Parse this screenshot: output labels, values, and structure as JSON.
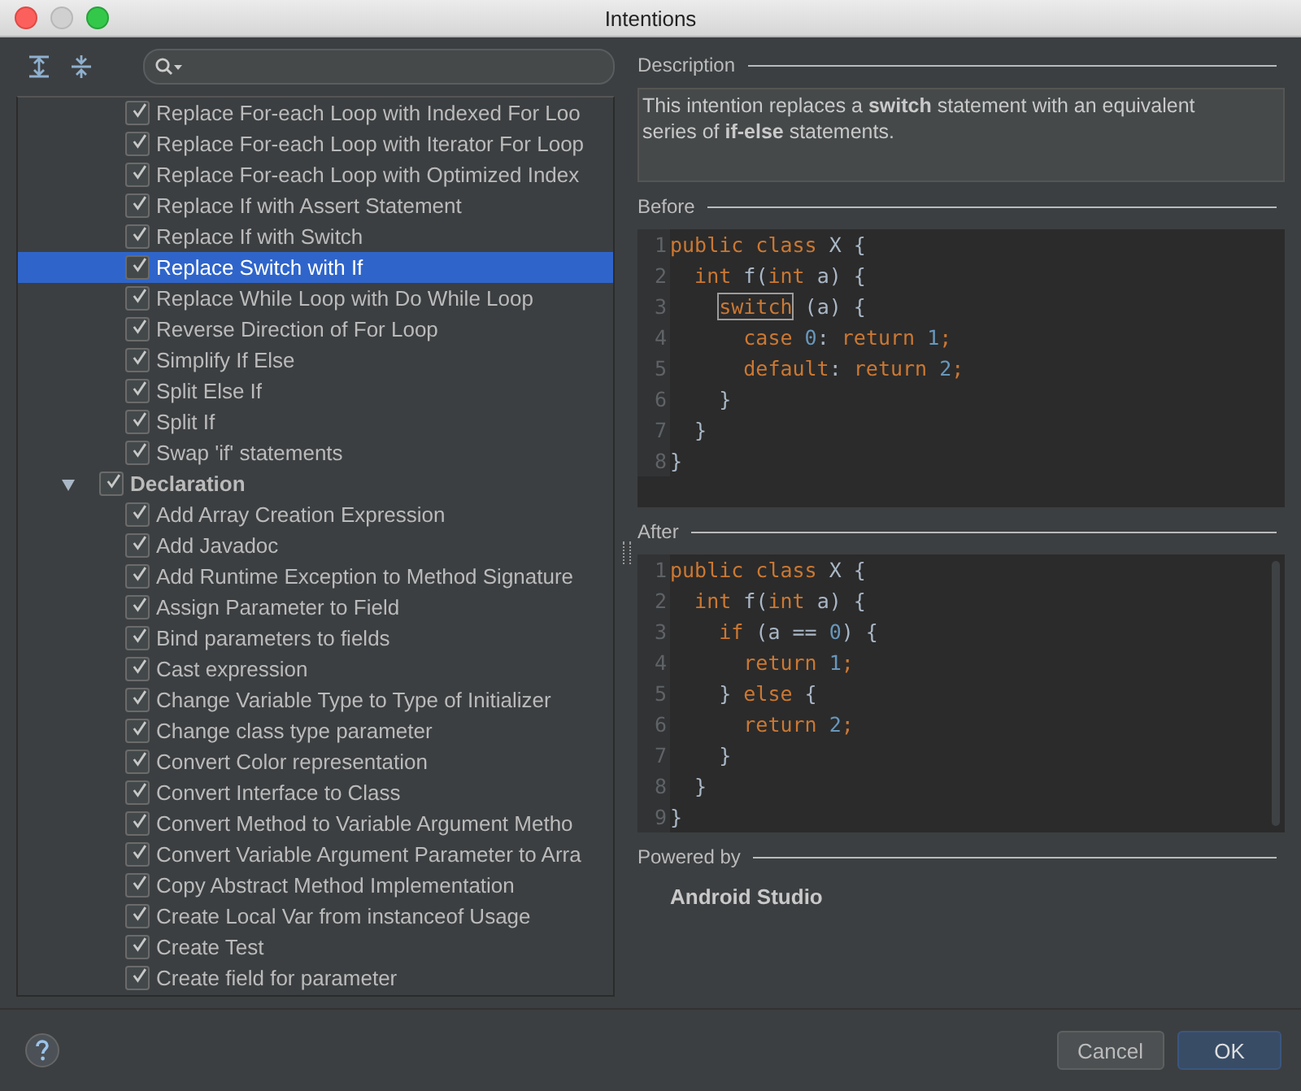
{
  "window": {
    "title": "Intentions"
  },
  "tree": [
    {
      "label": "Replace For-each Loop with Indexed For Loo",
      "checked": true,
      "selected": false
    },
    {
      "label": "Replace For-each Loop with Iterator For Loop",
      "checked": true,
      "selected": false
    },
    {
      "label": "Replace For-each Loop with Optimized Index",
      "checked": true,
      "selected": false
    },
    {
      "label": "Replace If with Assert Statement",
      "checked": true,
      "selected": false
    },
    {
      "label": "Replace If with Switch",
      "checked": true,
      "selected": false
    },
    {
      "label": "Replace Switch with If",
      "checked": true,
      "selected": true
    },
    {
      "label": "Replace While Loop with Do While Loop",
      "checked": true,
      "selected": false
    },
    {
      "label": "Reverse Direction of For Loop",
      "checked": true,
      "selected": false
    },
    {
      "label": "Simplify If Else",
      "checked": true,
      "selected": false
    },
    {
      "label": "Split Else If",
      "checked": true,
      "selected": false
    },
    {
      "label": "Split If",
      "checked": true,
      "selected": false
    },
    {
      "label": "Swap 'if' statements",
      "checked": true,
      "selected": false
    },
    {
      "label": "Declaration",
      "checked": true,
      "selected": false,
      "expanded": true,
      "children": [
        {
          "label": "Add Array Creation Expression",
          "checked": true,
          "selected": false
        },
        {
          "label": "Add Javadoc",
          "checked": true,
          "selected": false
        },
        {
          "label": "Add Runtime Exception to Method Signature",
          "checked": true,
          "selected": false
        },
        {
          "label": "Assign Parameter to Field",
          "checked": true,
          "selected": false
        },
        {
          "label": "Bind parameters to fields",
          "checked": true,
          "selected": false
        },
        {
          "label": "Cast expression",
          "checked": true,
          "selected": false
        },
        {
          "label": "Change Variable Type to Type of Initializer",
          "checked": true,
          "selected": false
        },
        {
          "label": "Change class type parameter",
          "checked": true,
          "selected": false
        },
        {
          "label": "Convert Color representation",
          "checked": true,
          "selected": false
        },
        {
          "label": "Convert Interface to Class",
          "checked": true,
          "selected": false
        },
        {
          "label": "Convert Method to Variable Argument Metho",
          "checked": true,
          "selected": false
        },
        {
          "label": "Convert Variable Argument Parameter to Arra",
          "checked": true,
          "selected": false
        },
        {
          "label": "Copy Abstract Method Implementation",
          "checked": true,
          "selected": false
        },
        {
          "label": "Create Local Var from instanceof Usage",
          "checked": true,
          "selected": false
        },
        {
          "label": "Create Test",
          "checked": true,
          "selected": false
        },
        {
          "label": "Create field for parameter",
          "checked": true,
          "selected": false
        }
      ]
    }
  ],
  "description": {
    "heading": "Description",
    "text": "This intention replaces a **switch** statement with an equivalent series of **if-else** statements."
  },
  "before": {
    "heading": "Before",
    "lines": [
      {
        "num": "1",
        "tokens": [
          {
            "kind": "kw",
            "t": "public class"
          },
          {
            "kind": "plain",
            "t": " X {"
          }
        ]
      },
      {
        "num": "2",
        "tokens": [
          {
            "kind": "kw",
            "t": "  int"
          },
          {
            "kind": "plain",
            "t": " f("
          },
          {
            "kind": "kw",
            "t": "int"
          },
          {
            "kind": "plain",
            "t": " a) {"
          }
        ]
      },
      {
        "num": "3",
        "tokens": [
          {
            "kind": "boxed",
            "t": "    switch"
          },
          {
            "kind": "plain",
            "t": " (a) {"
          }
        ]
      },
      {
        "num": "4",
        "tokens": [
          {
            "kind": "kw",
            "t": "      case"
          },
          {
            "kind": "num",
            "t": " 0"
          },
          {
            "kind": "plain",
            "t": ": "
          },
          {
            "kind": "kw",
            "t": "return"
          },
          {
            "kind": "num",
            "t": " 1"
          },
          {
            "kind": "kw",
            "t": ";"
          }
        ]
      },
      {
        "num": "5",
        "tokens": [
          {
            "kind": "kw",
            "t": "      default"
          },
          {
            "kind": "plain",
            "t": ": "
          },
          {
            "kind": "kw",
            "t": "return"
          },
          {
            "kind": "num",
            "t": " 2"
          },
          {
            "kind": "kw",
            "t": ";"
          }
        ]
      },
      {
        "num": "6",
        "tokens": [
          {
            "kind": "plain",
            "t": "    }"
          }
        ]
      },
      {
        "num": "7",
        "tokens": [
          {
            "kind": "plain",
            "t": "  }"
          }
        ]
      },
      {
        "num": "8",
        "tokens": [
          {
            "kind": "plain",
            "t": "}"
          }
        ]
      }
    ]
  },
  "after": {
    "heading": "After",
    "lines": [
      {
        "num": "1",
        "tokens": [
          {
            "kind": "kw",
            "t": "public class"
          },
          {
            "kind": "plain",
            "t": " X {"
          }
        ]
      },
      {
        "num": "2",
        "tokens": [
          {
            "kind": "kw",
            "t": "  int"
          },
          {
            "kind": "plain",
            "t": " f("
          },
          {
            "kind": "kw",
            "t": "int"
          },
          {
            "kind": "plain",
            "t": " a) {"
          }
        ]
      },
      {
        "num": "3",
        "tokens": [
          {
            "kind": "kw",
            "t": "    if"
          },
          {
            "kind": "plain",
            "t": " (a == "
          },
          {
            "kind": "num",
            "t": "0"
          },
          {
            "kind": "plain",
            "t": ") {"
          }
        ]
      },
      {
        "num": "4",
        "tokens": [
          {
            "kind": "kw",
            "t": "      return"
          },
          {
            "kind": "num",
            "t": " 1"
          },
          {
            "kind": "kw",
            "t": ";"
          }
        ]
      },
      {
        "num": "5",
        "tokens": [
          {
            "kind": "plain",
            "t": "    } "
          },
          {
            "kind": "kw",
            "t": "else"
          },
          {
            "kind": "plain",
            "t": " {"
          }
        ]
      },
      {
        "num": "6",
        "tokens": [
          {
            "kind": "kw",
            "t": "      return"
          },
          {
            "kind": "num",
            "t": " 2"
          },
          {
            "kind": "kw",
            "t": ";"
          }
        ]
      },
      {
        "num": "7",
        "tokens": [
          {
            "kind": "plain",
            "t": "    }"
          }
        ]
      },
      {
        "num": "8",
        "tokens": [
          {
            "kind": "plain",
            "t": "  }"
          }
        ]
      },
      {
        "num": "9",
        "tokens": [
          {
            "kind": "plain",
            "t": "}"
          }
        ]
      }
    ]
  },
  "powered_by": {
    "heading": "Powered by",
    "text": "Android Studio"
  },
  "buttons": [
    {
      "label": "Cancel",
      "kind": "secondary"
    },
    {
      "label": "OK",
      "kind": "default"
    }
  ]
}
